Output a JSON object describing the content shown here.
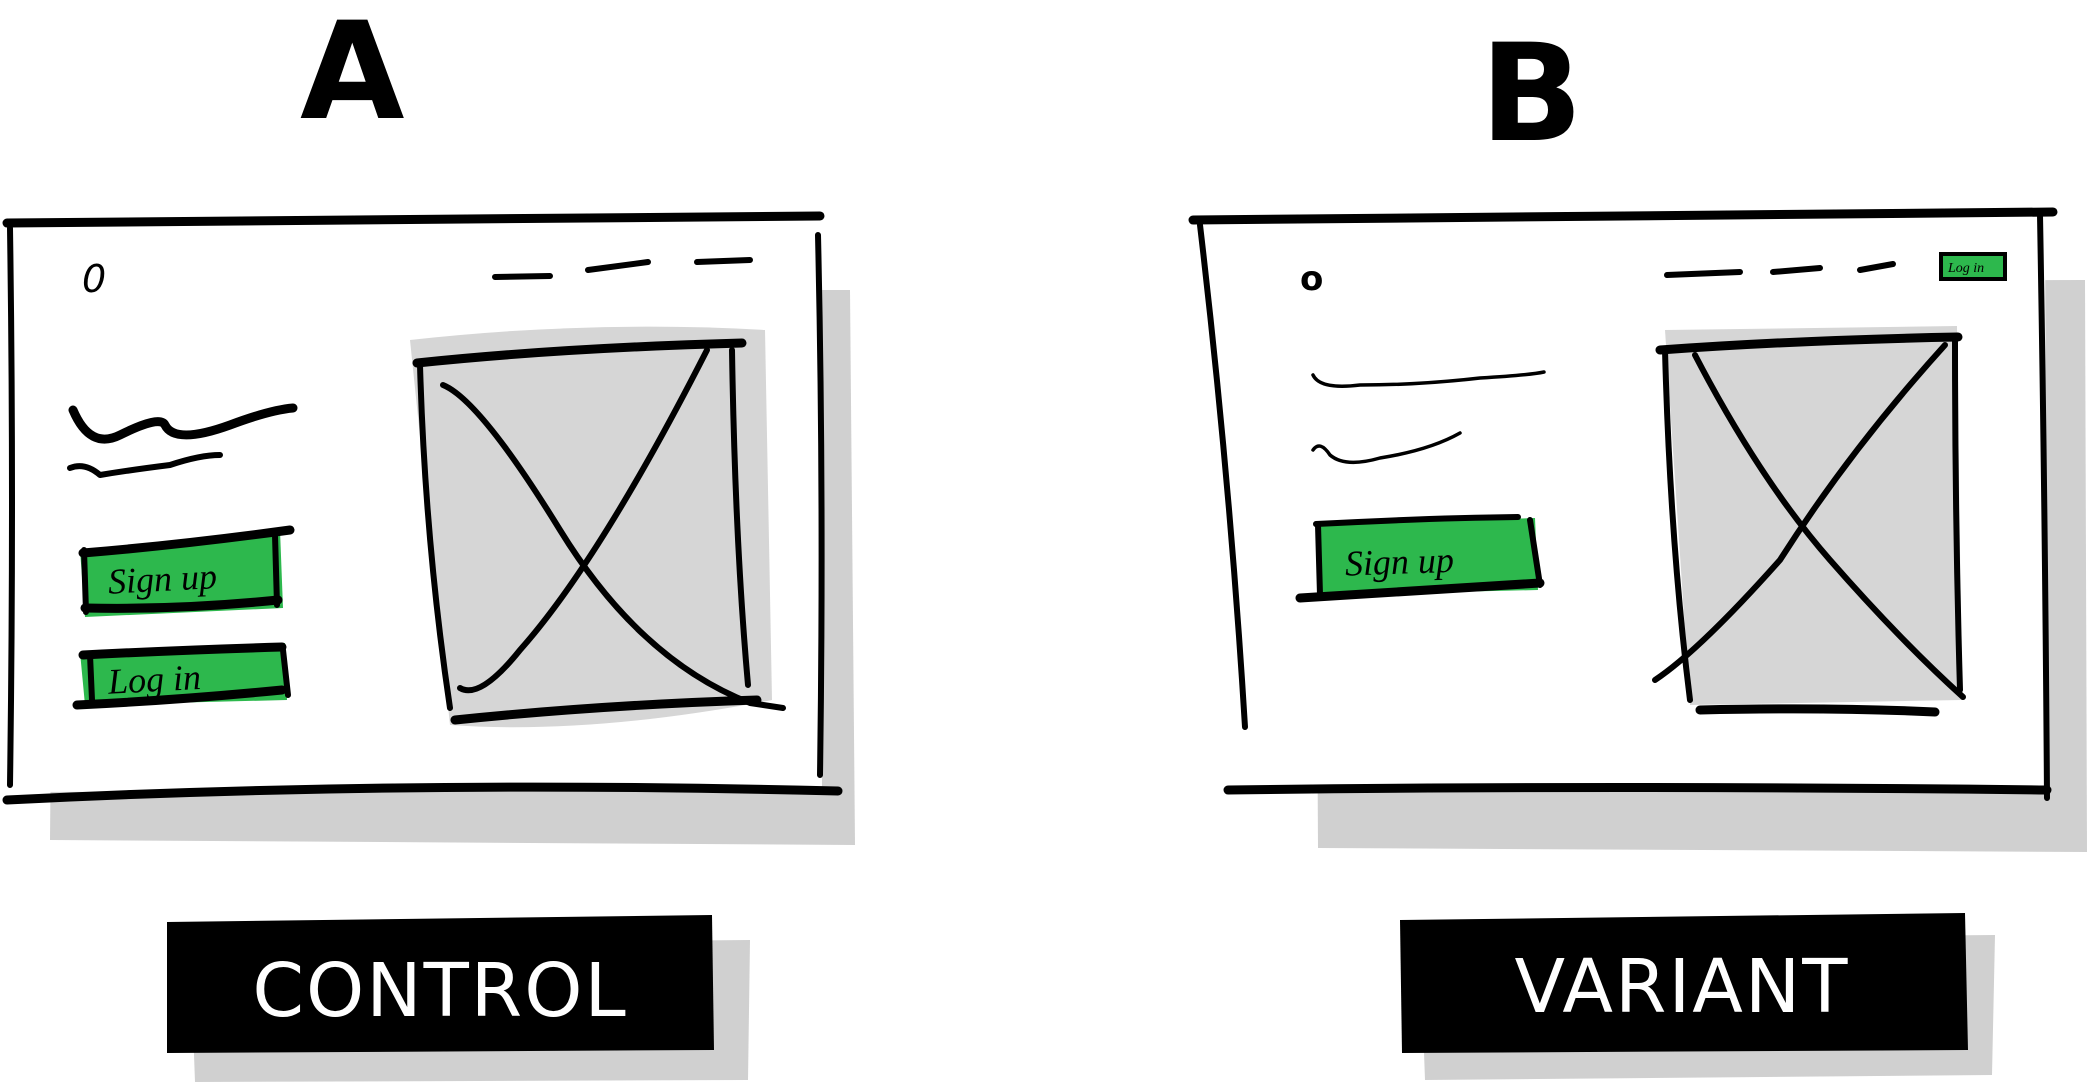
{
  "colors": {
    "ink": "#000000",
    "button_green": "#2db84d",
    "placeholder_gray": "#d6d6d6",
    "shadow_gray": "#d0d0d0"
  },
  "panels": [
    {
      "heading": "A",
      "label": "CONTROL",
      "buttons": [
        "Sign up",
        "Log in"
      ],
      "image_icon": "image-placeholder-icon"
    },
    {
      "heading": "B",
      "label": "VARIANT",
      "buttons": [
        "Sign up"
      ],
      "nav_button": "Log in",
      "image_icon": "image-placeholder-icon"
    }
  ]
}
